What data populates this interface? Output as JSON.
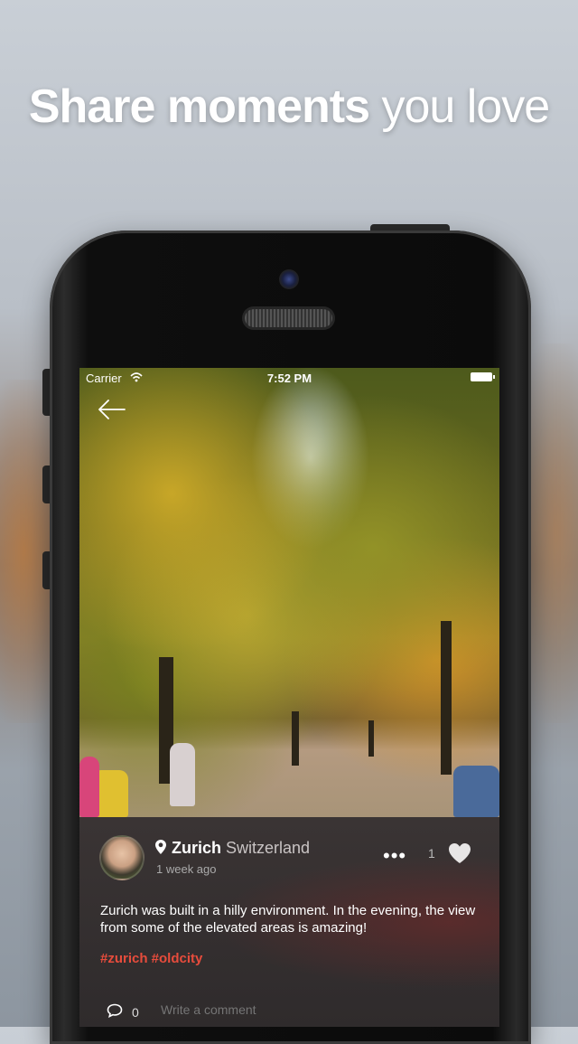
{
  "headline": {
    "bold": "Share moments",
    "light": " you love"
  },
  "status_bar": {
    "carrier": "Carrier",
    "time": "7:52 PM"
  },
  "post": {
    "location": {
      "city": "Zurich",
      "country": " Switzerland"
    },
    "time_ago": "1 week ago",
    "more_menu": "•••",
    "likes": "1",
    "body": "Zurich was built in a hilly environment. In the evening, the view from some of the elevated areas is amazing!",
    "tags": "#zurich #oldcity",
    "comments_count": "0",
    "comment_placeholder": "Write a comment"
  },
  "colors": {
    "accent": "#e74c3c",
    "panel": "#2f2b2c"
  }
}
